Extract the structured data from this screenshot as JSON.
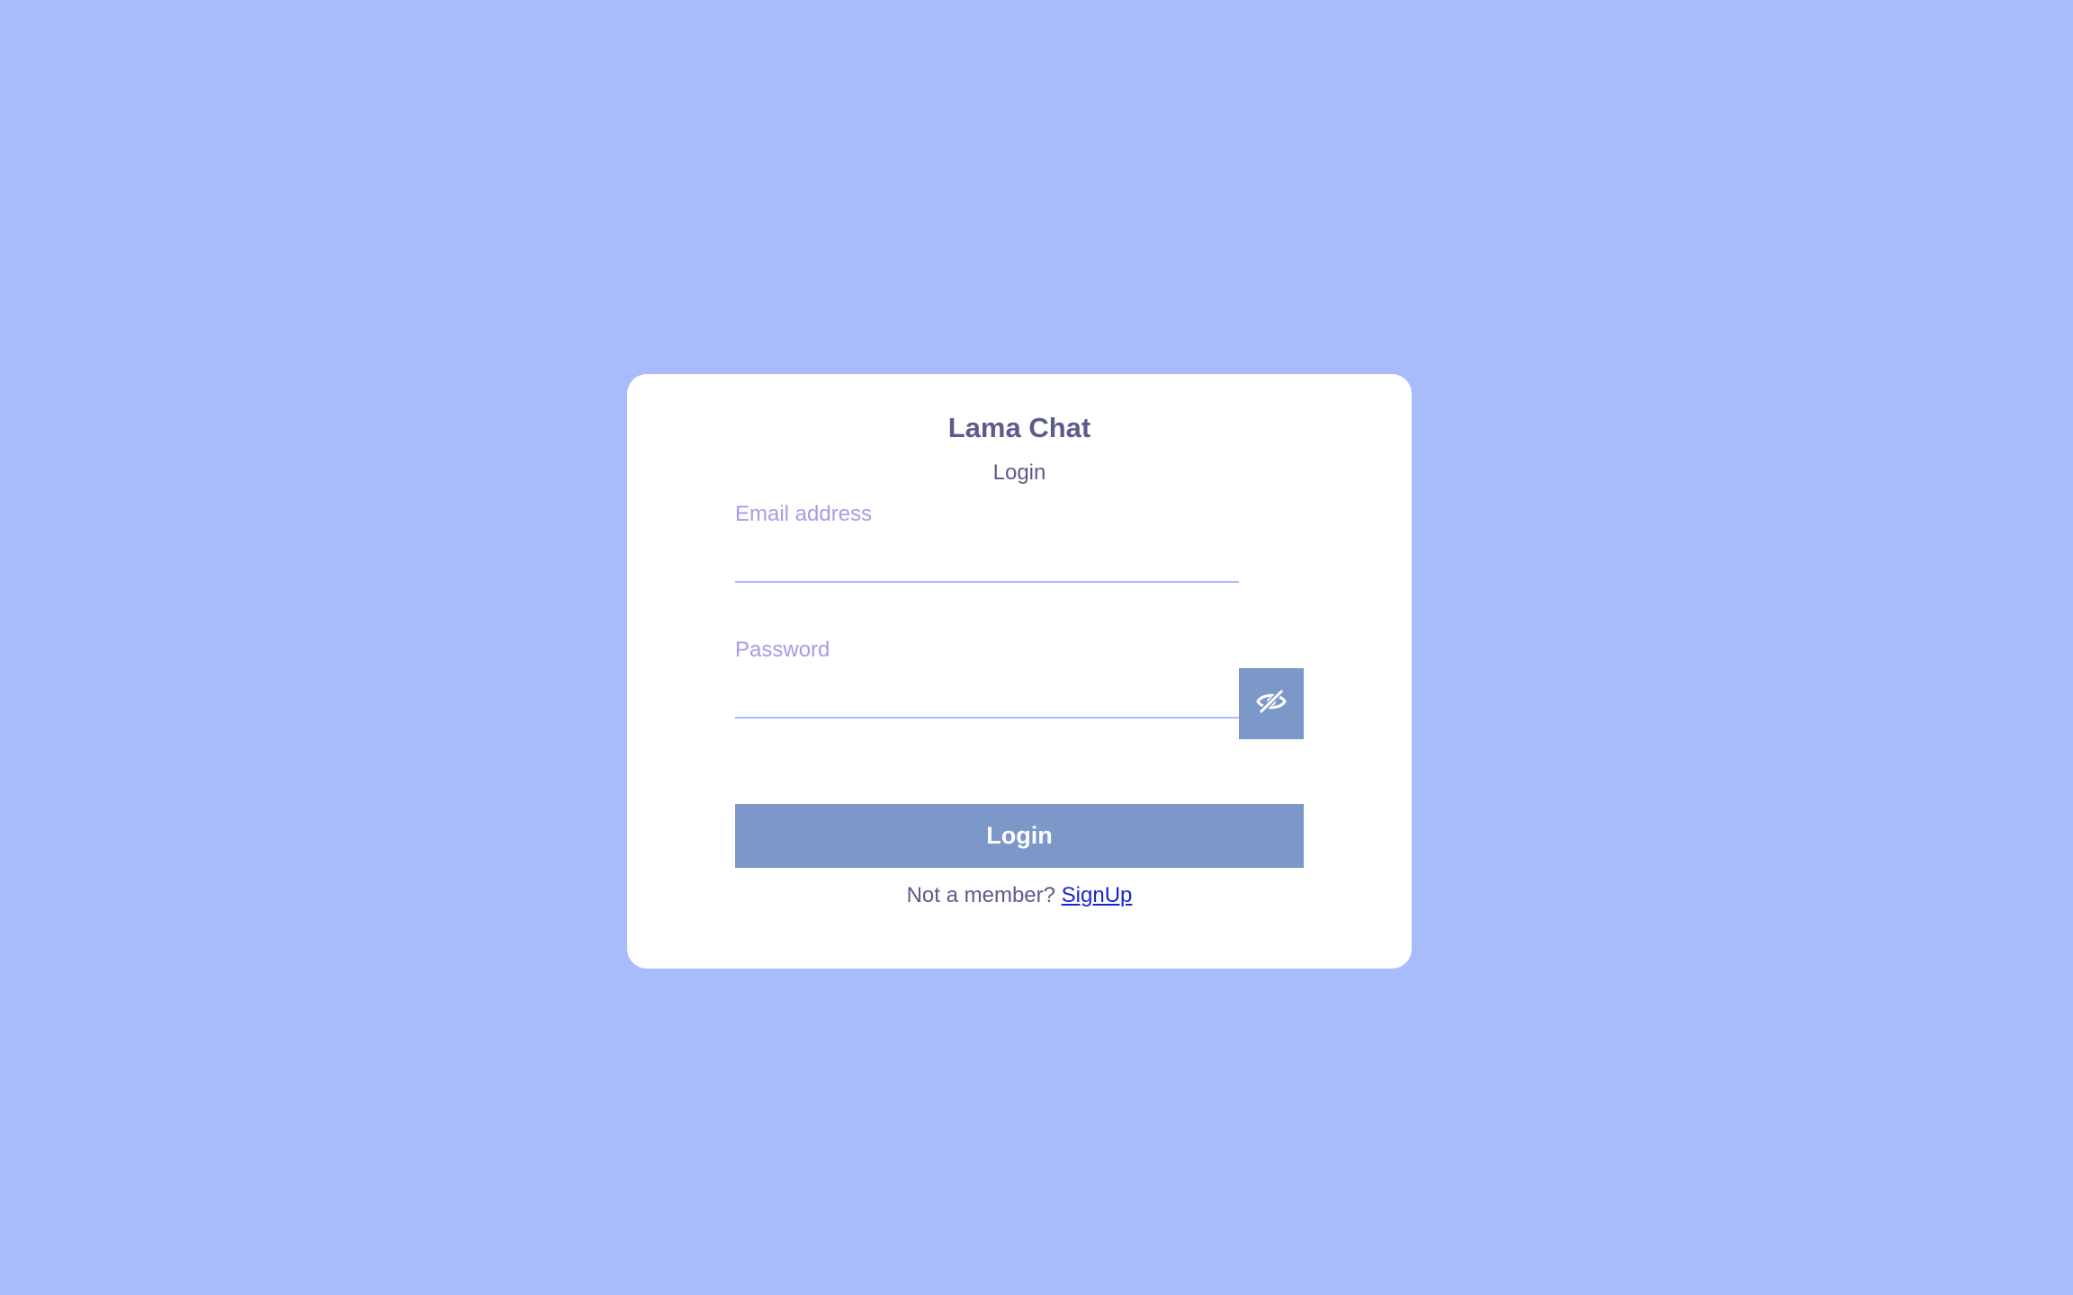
{
  "app": {
    "title": "Lama Chat",
    "subtitle": "Login"
  },
  "form": {
    "email": {
      "label": "Email address",
      "value": ""
    },
    "password": {
      "label": "Password",
      "value": "",
      "toggle_icon": "eye-off-icon"
    },
    "submit_label": "Login"
  },
  "footer": {
    "prompt": "Not a member?",
    "link_label": "SignUp"
  },
  "colors": {
    "background": "#a8bcfc",
    "card": "#ffffff",
    "heading": "#5b5b8c",
    "label": "#a99be6",
    "button": "#7b98c9",
    "link": "#1a24cf"
  }
}
